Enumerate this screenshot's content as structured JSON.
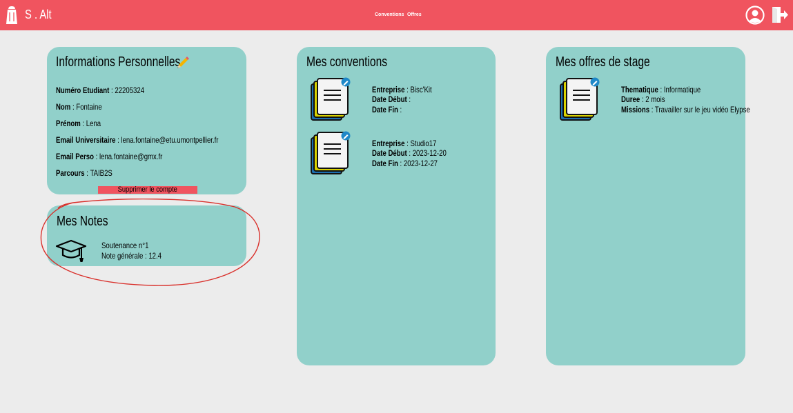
{
  "header": {
    "brand": "S . Alt",
    "nav": [
      {
        "label": "Conventions"
      },
      {
        "label": "Offres"
      }
    ],
    "icons": {
      "logo": "salt-shaker-icon",
      "user": "user-profile-icon",
      "logout": "logout-icon"
    }
  },
  "personal_info": {
    "title": "Informations Personnelles",
    "fields": [
      {
        "label": "Numéro Etudiant",
        "value": "22205324"
      },
      {
        "label": "Nom",
        "value": "Fontaine"
      },
      {
        "label": "Prénom",
        "value": "Lena"
      },
      {
        "label": "Email Universitaire",
        "value": "lena.fontaine@etu.umontpellier.fr"
      },
      {
        "label": "Email Perso",
        "value": "lena.fontaine@gmx.fr"
      },
      {
        "label": "Parcours",
        "value": "TAIB2S"
      }
    ],
    "delete_label": "Supprimer le compte"
  },
  "notes": {
    "title": "Mes Notes",
    "items": [
      {
        "name": "Soutenance n°1",
        "grade_label": "Note générale",
        "grade": "12.4"
      }
    ]
  },
  "conventions": {
    "title": "Mes conventions",
    "items": [
      {
        "company_label": "Entreprise",
        "company": "Bisc'Kit",
        "start_label": "Date Début",
        "start": "",
        "end_label": "Date Fin",
        "end": ""
      },
      {
        "company_label": "Entreprise",
        "company": "Studio17",
        "start_label": "Date Début",
        "start": "2023-12-20",
        "end_label": "Date Fin",
        "end": "2023-12-27"
      }
    ]
  },
  "offers": {
    "title": "Mes offres de stage",
    "items": [
      {
        "theme_label": "Thematique",
        "theme": "Informatique",
        "duration_label": "Duree",
        "duration": "2 mois",
        "missions_label": "Missions",
        "missions": "Travailler sur le jeu vidéo Elypse"
      }
    ]
  },
  "colors": {
    "header": "#f0545f",
    "card": "#91d0ca",
    "background": "#ececec",
    "annotation": "#d9302b",
    "edit_badge": "#1e88c8"
  }
}
